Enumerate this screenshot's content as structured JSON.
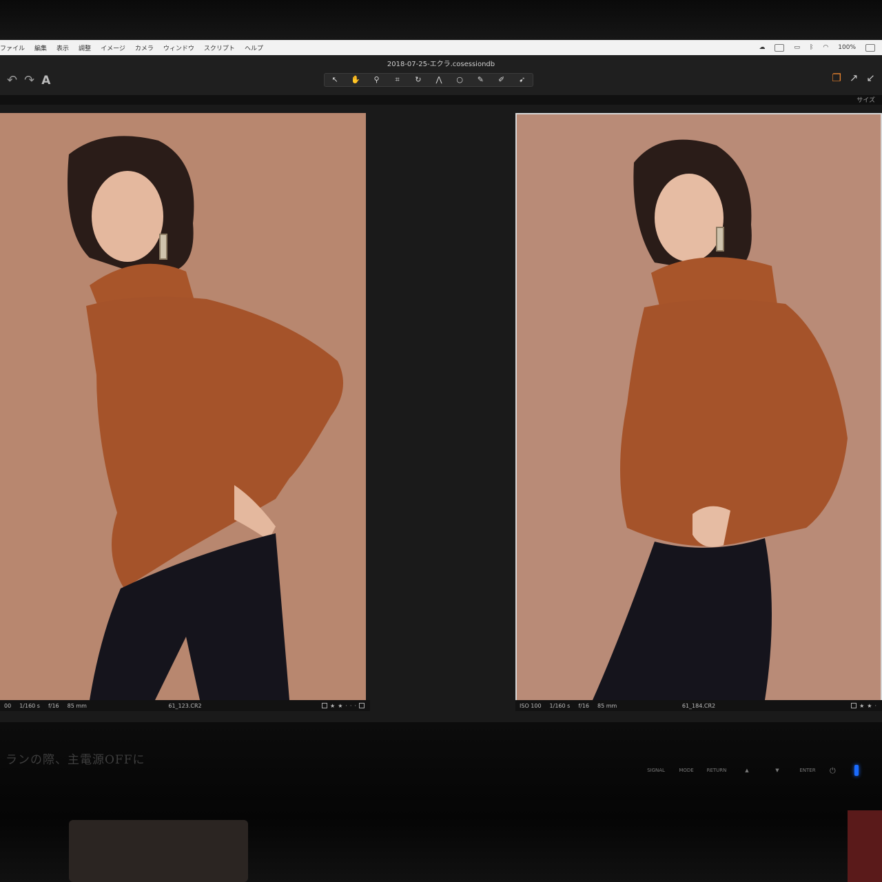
{
  "menubar": {
    "items": [
      "ファイル",
      "編集",
      "表示",
      "調整",
      "イメージ",
      "カメラ",
      "ウィンドウ",
      "スクリプト",
      "ヘルプ"
    ],
    "battery": "100%"
  },
  "window": {
    "title": "2018-07-25-エクラ.cosessiondb",
    "size_label": "サイズ"
  },
  "toolbar": {
    "tools": [
      {
        "name": "select-tool",
        "glyph": "↖"
      },
      {
        "name": "pan-tool",
        "glyph": "✋"
      },
      {
        "name": "zoom-tool",
        "glyph": "⚲"
      },
      {
        "name": "crop-tool",
        "glyph": "⌗"
      },
      {
        "name": "rotate-tool",
        "glyph": "↻"
      },
      {
        "name": "keystone-tool",
        "glyph": "⋀"
      },
      {
        "name": "spot-tool",
        "glyph": "○"
      },
      {
        "name": "picker-tool",
        "glyph": "✎"
      },
      {
        "name": "brush-tool",
        "glyph": "✐"
      },
      {
        "name": "eraser-tool",
        "glyph": "➹"
      }
    ],
    "active_tool_index": 1,
    "accent_color": "#e8832e"
  },
  "viewer": {
    "left": {
      "iso": "00",
      "shutter": "1/160 s",
      "aperture": "f/16",
      "focal": "85 mm",
      "filename": "61_123.CR2"
    },
    "right": {
      "iso": "ISO 100",
      "shutter": "1/160 s",
      "aperture": "f/16",
      "focal": "85 mm",
      "filename": "61_184.CR2"
    }
  },
  "monitor": {
    "sticker_text": "ランの際、主電源OFFに",
    "buttons": [
      "SIGNAL",
      "MODE",
      "RETURN",
      "▲",
      "▼",
      "ENTER"
    ],
    "power_glyph": "⏻"
  }
}
